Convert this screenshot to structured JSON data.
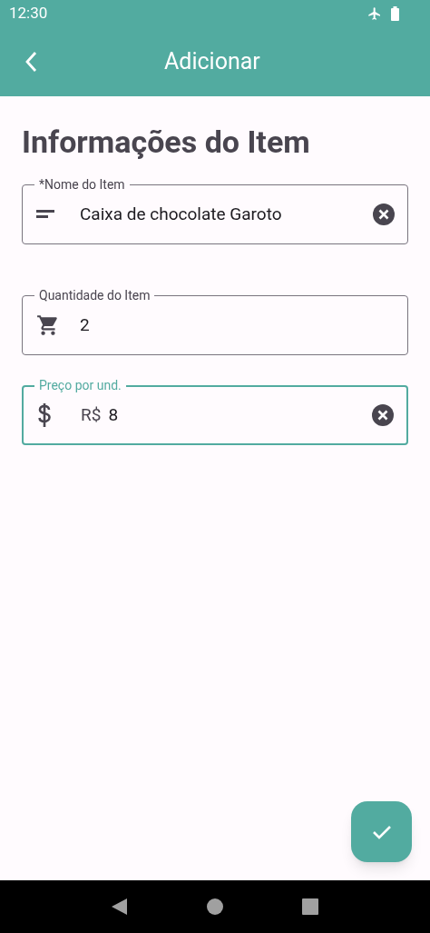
{
  "status_bar": {
    "time": "12:30"
  },
  "app_bar": {
    "title": "Adicionar"
  },
  "heading": "Informações do Item",
  "fields": [
    {
      "label": "*Nome do Item",
      "kind": "lines",
      "value": "Caixa de chocolate Garoto",
      "clearable": true,
      "focused": false
    },
    {
      "label": "Quantidade do Item",
      "kind": "cart",
      "value": "2",
      "clearable": false,
      "focused": false
    },
    {
      "label": "Preço por und.",
      "kind": "dollar",
      "prefix": "R$",
      "value": "8",
      "clearable": true,
      "focused": true
    }
  ]
}
